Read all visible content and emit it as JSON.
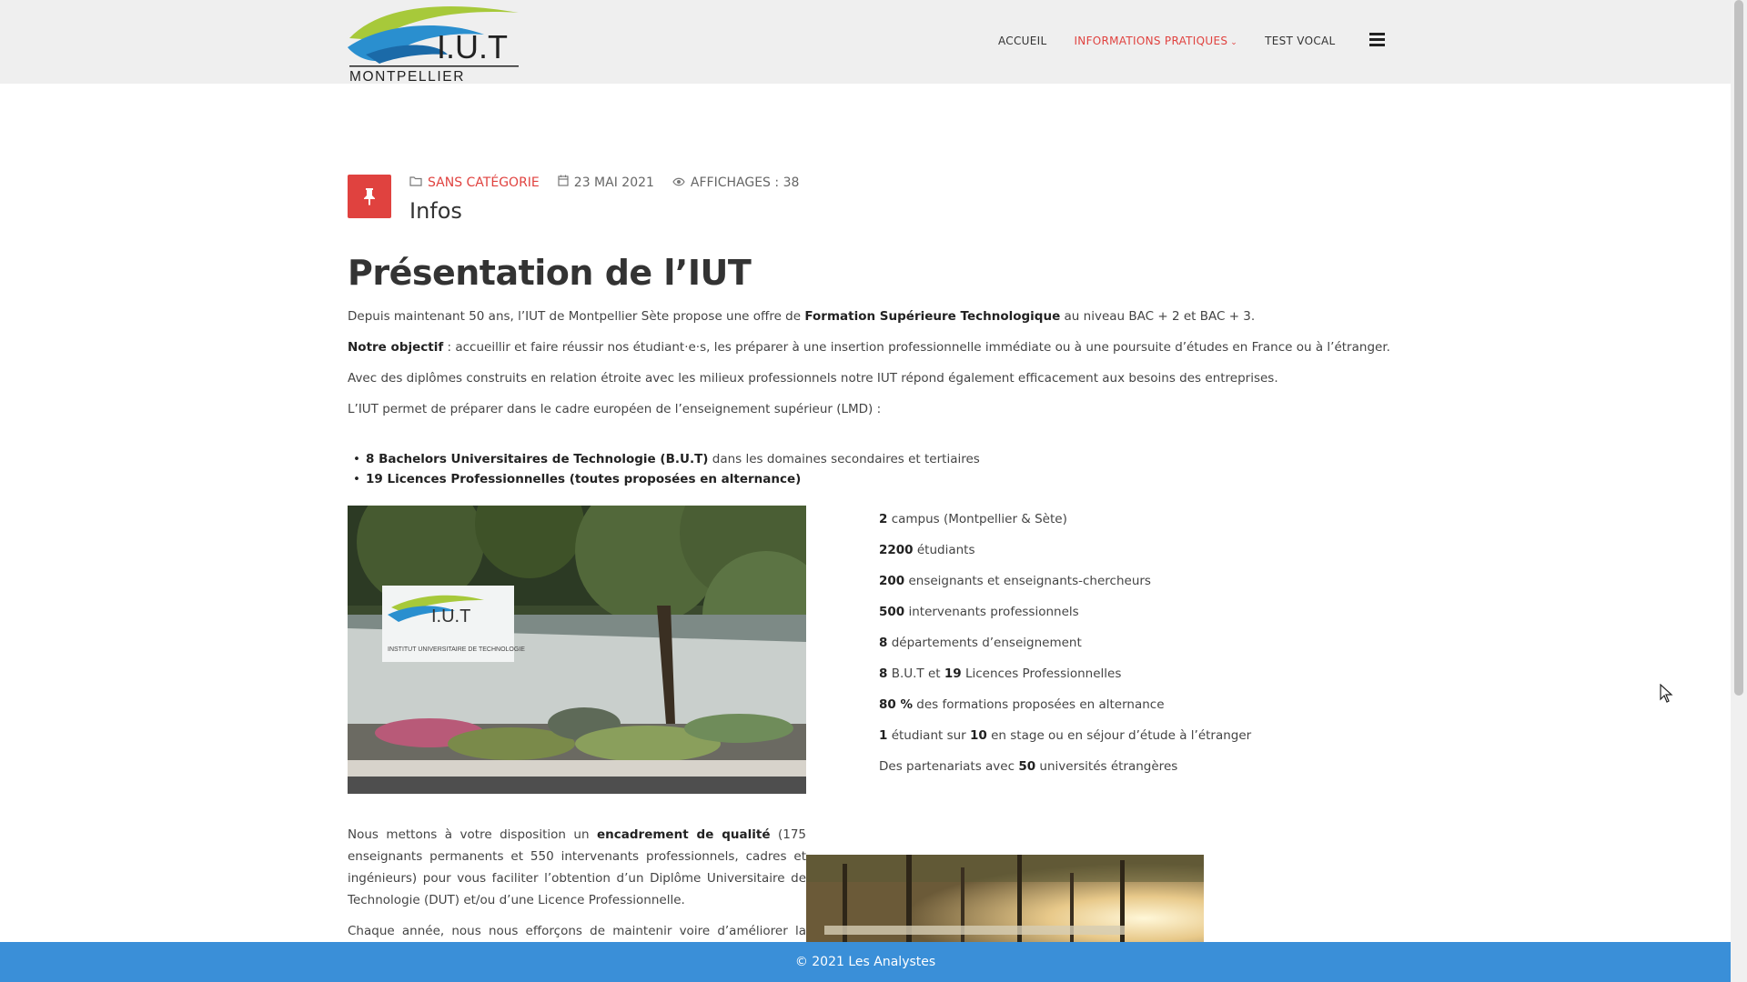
{
  "header": {
    "logo_text": "I.U.T",
    "logo_subtext": "MONTPELLIER",
    "nav": {
      "home": "ACCUEIL",
      "info": "INFORMATIONS PRATIQUES",
      "vocal": "TEST VOCAL"
    },
    "menu_icon": "hamburger-icon"
  },
  "post": {
    "category": "SANS CATÉGORIE",
    "date": "23 MAI 2021",
    "views": "AFFICHAGES : 38",
    "title": "Infos",
    "pin_icon": "pushpin-icon"
  },
  "content": {
    "heading": "Présentation de l’IUT",
    "intro_prefix": "Depuis maintenant 50 ans, l’IUT de Montpellier Sète propose une offre de ",
    "intro_bold": "Formation Supérieure Technologique",
    "intro_suffix": "  au niveau BAC + 2 et BAC + 3.",
    "objective_bold": "Notre objectif",
    "objective_text": " : accueillir et faire réussir nos étudiant·e·s, les préparer à une insertion professionnelle immédiate ou à une poursuite d’études en France ou à l’étranger.",
    "diplomas_text": "Avec des diplômes construits en relation étroite avec les milieux professionnels notre IUT répond également efficacement aux besoins des entreprises.",
    "lmd_text": "L’IUT permet de préparer dans le cadre européen de l’enseignement supérieur (LMD) :",
    "bullets": [
      {
        "bold": "8 Bachelors Universitaires de Technologie (B.U.T)",
        "text": " dans les domaines secondaires et tertiaires"
      },
      {
        "bold": "19 Licences Professionnelles (toutes proposées en alternance)",
        "text": ""
      }
    ],
    "stats": [
      {
        "bold": "2",
        "text": " campus (Montpellier & Sète)"
      },
      {
        "bold": "2200",
        "text": " étudiants"
      },
      {
        "bold": "200",
        "text": " enseignants et enseignants-chercheurs"
      },
      {
        "bold": "500",
        "text": " intervenants professionnels"
      },
      {
        "bold": "8",
        "text": " départements d’enseignement"
      },
      {
        "bold": "8",
        "text": " B.U.T et ",
        "bold2": "19",
        "text2": " Licences Professionnelles"
      },
      {
        "bold": "80 %",
        "text": " des formations proposées en alternance"
      },
      {
        "bold": "1",
        "text": " étudiant sur ",
        "bold2": "10",
        "text2": " en stage ou en séjour d’étude à l’étranger"
      },
      {
        "text": "Des partenariats avec ",
        "bold2": "50",
        "text2": " universités étrangères"
      }
    ],
    "para_support_prefix": "Nous mettons à votre disposition un ",
    "para_support_bold": "encadrement de qualité",
    "para_support_suffix": " (175 enseignants permanents et 550 intervenants professionnels, cadres et ingénieurs) pour vous faciliter l’obtention d’un Diplôme Universitaire de Technologie (DUT) et/ou d’une Licence Professionnelle.",
    "para_yearly": "Chaque année, nous nous efforçons de maintenir voire d’améliorer la",
    "sign_text": "I.U.T",
    "sign_sub": "INSTITUT UNIVERSITAIRE DE TECHNOLOGIE"
  },
  "footer": {
    "text": "© 2021 Les Analystes"
  },
  "colors": {
    "accent": "#e0423f",
    "footer_bg": "#3a8fd8",
    "header_bg": "#efefef"
  }
}
